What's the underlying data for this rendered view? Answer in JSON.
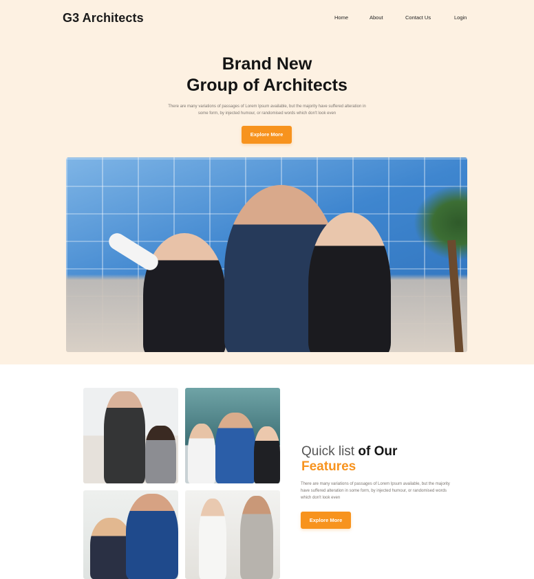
{
  "brand": {
    "name": "G3 Architects"
  },
  "nav": {
    "items": [
      "Home",
      "About",
      "Contact Us",
      "Login"
    ]
  },
  "hero": {
    "title_line1": "Brand New",
    "title_line2": "Group of Architects",
    "text_line1": "There are many variations of passages of Lorem Ipsum available, but the majority have suffered alteration in",
    "text_line2": "some form, by injected humour, or randomised words which don't look even",
    "button": "Explore More"
  },
  "features": {
    "heading_light": "Quick list",
    "heading_bold": "of Our",
    "heading_accent": "Features",
    "text": "There are many variations of passages of Lorem Ipsum available, but the majority have suffered alteration in some form, by injected humour, or randomised words which don't look even",
    "button": "Explore More"
  },
  "colors": {
    "accent": "#f7931e",
    "hero_bg": "#fdf1e2"
  }
}
